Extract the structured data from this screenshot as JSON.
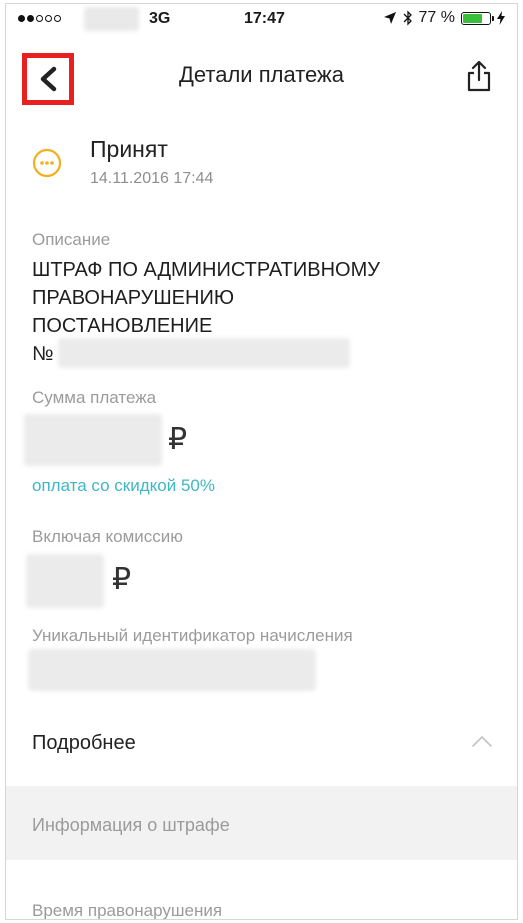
{
  "status_bar": {
    "network": "3G",
    "time": "17:47",
    "battery": "77 %",
    "battery_level": 0.77,
    "signal_filled": 2,
    "signal_total": 5
  },
  "nav": {
    "title": "Детали платежа",
    "back_icon": "chevron-left-icon",
    "share_icon": "share-icon",
    "highlight_color": "#e82020"
  },
  "payment_status": {
    "title": "Принят",
    "datetime": "14.11.2016 17:44",
    "icon": "pending-icon",
    "icon_color": "#f2b01e"
  },
  "description": {
    "label": "Описание",
    "line1": "ШТРАФ ПО АДМИНИСТРАТИВНОМУ",
    "line2": "ПРАВОНАРУШЕНИЮ",
    "line3": "ПОСТАНОВЛЕНИЕ",
    "number_prefix": "№"
  },
  "amount": {
    "label": "Сумма платежа",
    "currency": "₽",
    "discount_note": "оплата со скидкой 50%",
    "discount_color": "#3fb6c4"
  },
  "commission": {
    "label": "Включая комиссию",
    "currency": "₽"
  },
  "uin": {
    "label": "Уникальный идентификатор начисления"
  },
  "more": {
    "label": "Подробнее",
    "icon": "chevron-up-icon"
  },
  "fine_info": {
    "label": "Информация о штрафе"
  },
  "violation_time": {
    "label": "Время правонарушения"
  }
}
